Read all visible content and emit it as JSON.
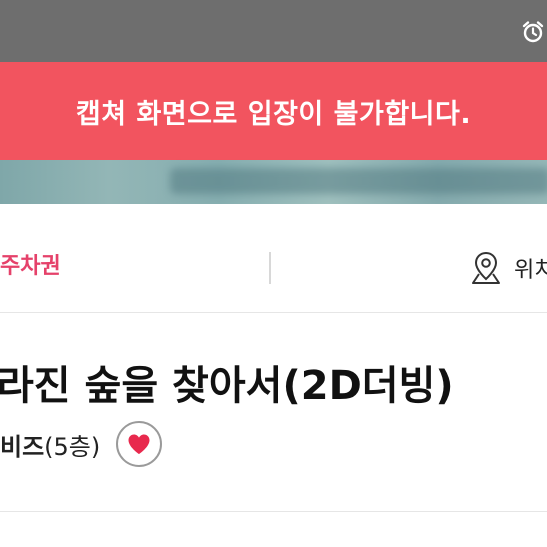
{
  "status_bar": {
    "icons": [
      "alarm-clock-icon"
    ]
  },
  "capture_warning": {
    "text": "캡쳐 화면으로 입장이 불가합니다.",
    "color": "#f2545f"
  },
  "info_bar": {
    "parking_label": "주차권",
    "location_label": "위치",
    "location_icon": "map-pin-icon",
    "accent_color": "#e5416a"
  },
  "show": {
    "title": "라진 숲을 찾아서(2D더빙)",
    "venue_name": "비즈",
    "venue_floor": "(5층)",
    "favorite_icon": "heart-icon",
    "favorite_color": "#e8294d"
  }
}
